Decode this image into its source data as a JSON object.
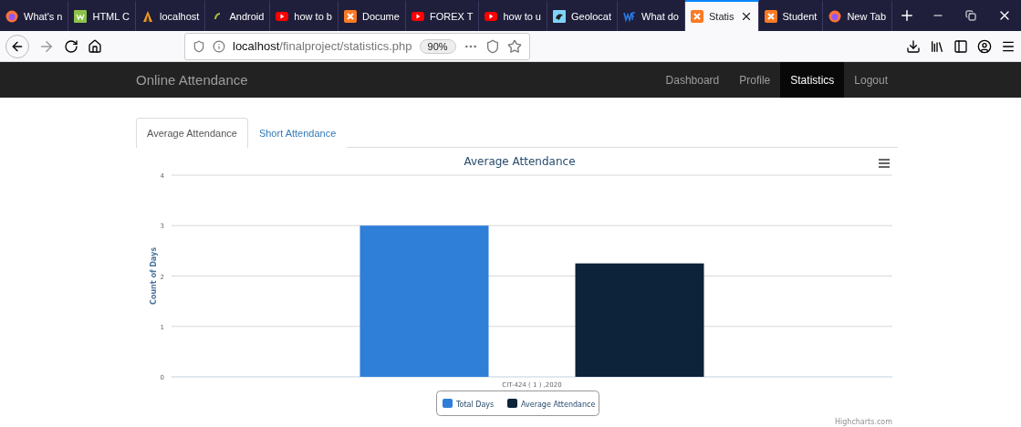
{
  "browser": {
    "tabs": [
      {
        "label": "What's n",
        "kind": "firefox",
        "selected": false
      },
      {
        "label": "HTML C",
        "kind": "w3",
        "selected": false
      },
      {
        "label": "localhost",
        "kind": "mail",
        "selected": false
      },
      {
        "label": "Android",
        "kind": "android",
        "selected": false
      },
      {
        "label": "how to b",
        "kind": "youtube",
        "selected": false
      },
      {
        "label": "Docume",
        "kind": "xampp",
        "selected": false
      },
      {
        "label": "FOREX T",
        "kind": "youtube",
        "selected": false
      },
      {
        "label": "how to u",
        "kind": "youtube",
        "selected": false
      },
      {
        "label": "Geolocat",
        "kind": "geo",
        "selected": false
      },
      {
        "label": "What do",
        "kind": "wf",
        "selected": false
      },
      {
        "label": "Statis",
        "kind": "xampp",
        "selected": true
      },
      {
        "label": "Student",
        "kind": "xampp",
        "selected": false
      },
      {
        "label": "New Tab",
        "kind": "firefox",
        "selected": false
      }
    ],
    "address": {
      "host": "localhost",
      "path": "/finalproject/statistics.php"
    },
    "zoom": "90%"
  },
  "navbar": {
    "brand": "Online Attendance",
    "items": [
      {
        "label": "Dashboard",
        "selected": false
      },
      {
        "label": "Profile",
        "selected": false
      },
      {
        "label": "Statistics",
        "selected": true
      },
      {
        "label": "Logout",
        "selected": false
      }
    ]
  },
  "page_tabs": [
    {
      "label": "Average Attendance",
      "selected": true
    },
    {
      "label": "Short Attendance",
      "selected": false
    }
  ],
  "chart": {
    "chart_data": {
      "type": "bar",
      "title": "Average Attendance",
      "ylabel": "Count of Days",
      "categories": [
        "CIT-424 ( 1 ) ,2020"
      ],
      "series": [
        {
          "name": "Total Days",
          "color": "#2f7ed8",
          "values": [
            3
          ]
        },
        {
          "name": "Average Attendance",
          "color": "#0d233a",
          "values": [
            2.25
          ]
        }
      ],
      "ylim": [
        0,
        4
      ],
      "yticks": [
        0,
        1,
        2,
        3,
        4
      ],
      "grid": true,
      "legend": true
    },
    "credits": "Highcharts.com"
  }
}
